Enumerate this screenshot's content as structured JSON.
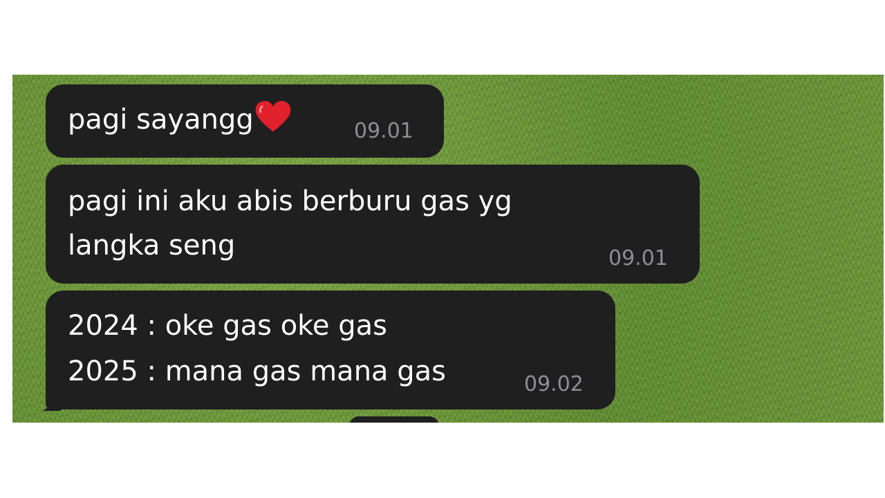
{
  "messages": [
    {
      "text": "pagi sayangg",
      "emoji": "heart-icon",
      "time": "09.01"
    },
    {
      "line1": "pagi ini aku abis berburu gas yg",
      "line2": "langka seng",
      "time": "09.01"
    },
    {
      "line1": "2024 : oke gas oke gas",
      "line2": "2025 : mana gas mana gas",
      "time": "09.02"
    }
  ],
  "colors": {
    "bubble": "#1f1f1f",
    "text": "#ffffff",
    "timestamp": "#8e8e93",
    "heart": "#e0202a"
  }
}
